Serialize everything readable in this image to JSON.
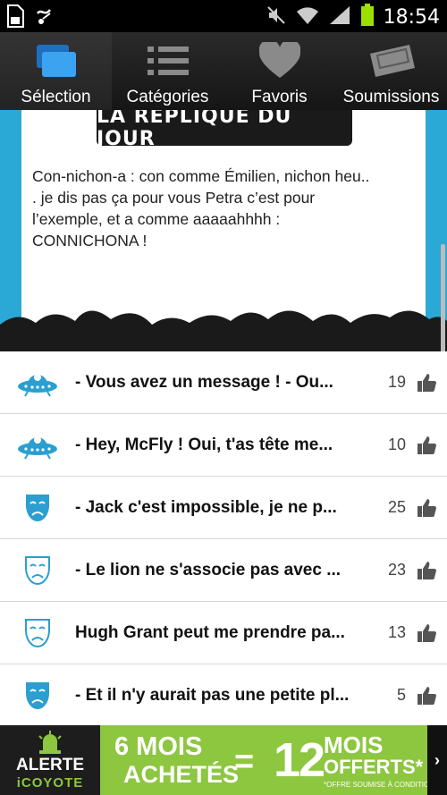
{
  "status_bar": {
    "time": "18:54",
    "left_icons": [
      "sd-card-icon",
      "usb-debug-icon"
    ],
    "right_icons": [
      "mute-icon",
      "wifi-icon",
      "signal-icon",
      "battery-icon"
    ]
  },
  "tabs": [
    {
      "label": "Sélection",
      "icon": "windows-icon",
      "active": true
    },
    {
      "label": "Catégories",
      "icon": "list-icon",
      "active": false
    },
    {
      "label": "Favoris",
      "icon": "heart-icon",
      "active": false
    },
    {
      "label": "Soumissions",
      "icon": "ticket-icon",
      "active": false
    }
  ],
  "replique": {
    "title": "LA REPLIQUE DU JOUR",
    "line1": "Con-nichon-a : con comme Émilien, nichon heu..",
    "line2": ". je dis pas ça pour vous Petra c’est pour",
    "line3": "l’exemple, et a comme aaaaahhhh :",
    "line4": "CONNICHONA !"
  },
  "list": {
    "items": [
      {
        "title": "- Vous avez un message ! - Ou...",
        "count": "19",
        "icon": "ufo-icon"
      },
      {
        "title": "- Hey, McFly ! Oui, t'as tête me...",
        "count": "10",
        "icon": "ufo-icon"
      },
      {
        "title": "- Jack c'est impossible, je ne p...",
        "count": "25",
        "icon": "sad-mask-icon"
      },
      {
        "title": "- Le lion ne s'associe pas avec ...",
        "count": "23",
        "icon": "sad-mask-outline-icon"
      },
      {
        "title": "Hugh Grant peut me prendre pa...",
        "count": "13",
        "icon": "sad-mask-outline-icon"
      },
      {
        "title": "- Et il n'y aurait pas une petite pl...",
        "count": "5",
        "icon": "sad-mask-icon"
      }
    ]
  },
  "ad": {
    "brand_line1": "ALERTE",
    "brand_line2": "iCOYOTE",
    "left_line1": "6 MOIS",
    "left_line2": "ACHETÉS",
    "equals": "=",
    "big_number": "12",
    "right_line1": "MOIS",
    "right_line2": "OFFERTS*",
    "conditions": "*OFFRE SOUMISE À CONDITIONS",
    "arrow": "›"
  },
  "colors": {
    "accent_blue": "#2aa9d6",
    "ad_green": "#8dc63f",
    "tab_bg": "#1e1e1e"
  }
}
